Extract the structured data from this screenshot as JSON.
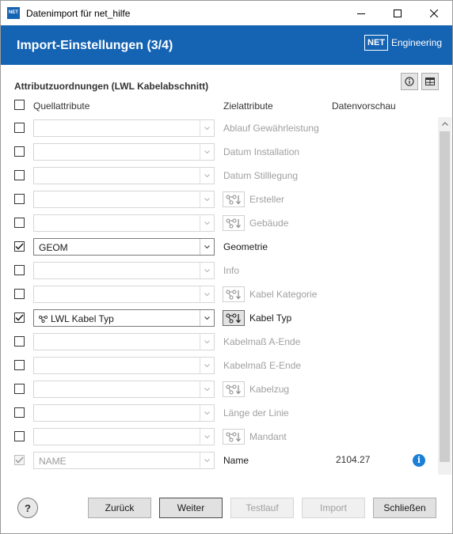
{
  "window": {
    "title": "Datenimport für net_hilfe",
    "app_icon_text": "NET"
  },
  "banner": {
    "title": "Import-Einstellungen (3/4)",
    "logo_box": "NET",
    "logo_text": "Engineering"
  },
  "section": {
    "title": "Attributzuordnungen (LWL Kabelabschnitt)"
  },
  "columns": {
    "source": "Quellattribute",
    "target": "Zielattribute",
    "preview": "Datenvorschau"
  },
  "rows": [
    {
      "checked": false,
      "source": "",
      "target": "Ablauf Gewährleistung",
      "link": false,
      "target_active": false,
      "preview": ""
    },
    {
      "checked": false,
      "source": "",
      "target": "Datum Installation",
      "link": false,
      "target_active": false,
      "preview": ""
    },
    {
      "checked": false,
      "source": "",
      "target": "Datum Stilllegung",
      "link": false,
      "target_active": false,
      "preview": ""
    },
    {
      "checked": false,
      "source": "",
      "target": "Ersteller",
      "link": true,
      "target_active": false,
      "preview": ""
    },
    {
      "checked": false,
      "source": "",
      "target": "Gebäude",
      "link": true,
      "target_active": false,
      "preview": ""
    },
    {
      "checked": true,
      "source": "GEOM",
      "target": "Geometrie",
      "link": false,
      "target_active": true,
      "preview": ""
    },
    {
      "checked": false,
      "source": "",
      "target": "Info",
      "link": false,
      "target_active": false,
      "preview": ""
    },
    {
      "checked": false,
      "source": "",
      "target": "Kabel Kategorie",
      "link": true,
      "target_active": false,
      "preview": ""
    },
    {
      "checked": true,
      "source": "LWL Kabel Typ",
      "source_icon": "relation-icon",
      "target": "Kabel Typ",
      "link": true,
      "target_active": true,
      "preview": ""
    },
    {
      "checked": false,
      "source": "",
      "target": "Kabelmaß A-Ende",
      "link": false,
      "target_active": false,
      "preview": ""
    },
    {
      "checked": false,
      "source": "",
      "target": "Kabelmaß E-Ende",
      "link": false,
      "target_active": false,
      "preview": ""
    },
    {
      "checked": false,
      "source": "",
      "target": "Kabelzug",
      "link": true,
      "target_active": false,
      "preview": ""
    },
    {
      "checked": false,
      "source": "",
      "target": "Länge der Linie",
      "link": false,
      "target_active": false,
      "preview": ""
    },
    {
      "checked": false,
      "source": "",
      "target": "Mandant",
      "link": true,
      "target_active": false,
      "preview": ""
    },
    {
      "checked": true,
      "disabled": true,
      "source": "NAME",
      "target": "Name",
      "link": false,
      "target_active": true,
      "preview": "2104.27",
      "info": true
    }
  ],
  "footer": {
    "help": "?",
    "back": "Zurück",
    "next": "Weiter",
    "test": "Testlauf",
    "import": "Import",
    "close": "Schließen"
  },
  "colors": {
    "accent": "#1563b3",
    "info": "#1a7fd6"
  }
}
